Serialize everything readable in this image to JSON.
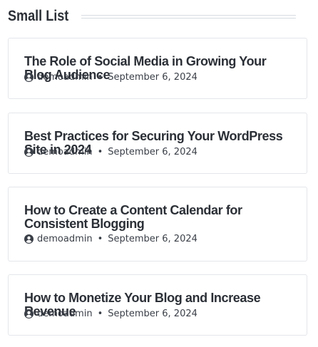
{
  "widget": {
    "title": "Small List"
  },
  "posts": [
    {
      "title": "The Role of Social Media in Growing Your Blog Audience",
      "author": "demoadmin",
      "date": "September 6, 2024"
    },
    {
      "title": "Best Practices for Securing Your WordPress Site in 2024",
      "author": "demoadmin",
      "date": "September 6, 2024"
    },
    {
      "title": "How to Create a Content Calendar for Consistent Blogging",
      "author": "demoadmin",
      "date": "September 6, 2024"
    },
    {
      "title": "How to Monetize Your Blog and Increase Revenue",
      "author": "demoadmin",
      "date": "September 6, 2024"
    }
  ],
  "meta_separator": "•",
  "icons": {
    "author": "user-circle-icon"
  },
  "colors": {
    "text": "#2b2f36",
    "border": "#e4e6ea",
    "rule": "#d8dce1"
  }
}
